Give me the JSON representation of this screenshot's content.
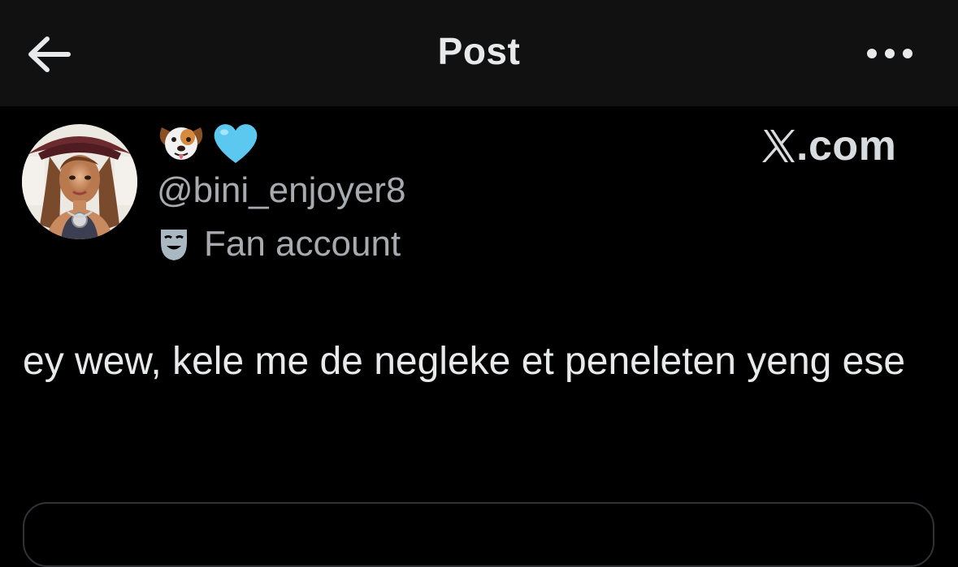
{
  "header": {
    "back_icon": "arrow-left-icon",
    "title": "Post",
    "more_icon": "more-horizontal-icon"
  },
  "post": {
    "display_name_emojis": [
      "dog-face-emoji",
      "light-blue-heart-emoji"
    ],
    "handle": "@bini_enjoyer8",
    "account_label": {
      "icon": "theater-mask-icon",
      "text": "Fan account"
    },
    "text": "ey wew, kele me de negleke et peneleten yeng ese"
  },
  "watermark": {
    "text": ".com",
    "logo_icon": "x-logo-icon"
  },
  "colors": {
    "background": "#000000",
    "header_background": "#111111",
    "primary_text": "#e7e9ea",
    "secondary_text": "#a7abb0",
    "heart": "#5cc8f0",
    "border": "#2f3336"
  }
}
